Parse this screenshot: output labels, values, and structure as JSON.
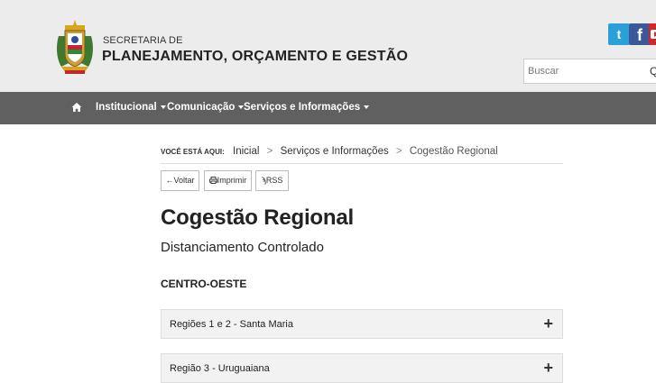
{
  "header": {
    "org_line1": "SECRETARIA DE",
    "org_line2": "PLANEJAMENTO, ORÇAMENTO E GESTÃO",
    "social": [
      {
        "name": "twitter-icon",
        "glyph": "t"
      },
      {
        "name": "facebook-icon",
        "glyph": "f"
      },
      {
        "name": "youtube-icon",
        "glyph": ""
      }
    ],
    "search": {
      "placeholder": "Buscar",
      "button_glyph": "Q"
    }
  },
  "nav": {
    "items": [
      {
        "label": "Institucional"
      },
      {
        "label": "Comunicação"
      },
      {
        "label": "Serviços e Informações"
      }
    ]
  },
  "breadcrumb": {
    "label": "VOCÊ ESTÁ AQUI:",
    "items": [
      "Inicial",
      "Serviços e Informações",
      "Cogestão Regional"
    ],
    "separator": ">"
  },
  "actions": {
    "back": "Voltar",
    "print": "Imprimir",
    "rss": "RSS"
  },
  "page": {
    "title": "Cogestão Regional",
    "subtitle": "Distanciamento Controlado",
    "region_heading": "CENTRO-OESTE"
  },
  "accordion": [
    {
      "label": "Regiões 1 e 2 - Santa Maria",
      "toggle": "+"
    },
    {
      "label": "Região 3 - Uruguaiana",
      "toggle": "+"
    }
  ],
  "colors": {
    "header_bg": "#ececec",
    "nav_bg": "#606060",
    "panel_bg": "#f2f2f2",
    "twitter": "#2a9fd8",
    "facebook": "#3b5998",
    "youtube": "#d2262a"
  }
}
